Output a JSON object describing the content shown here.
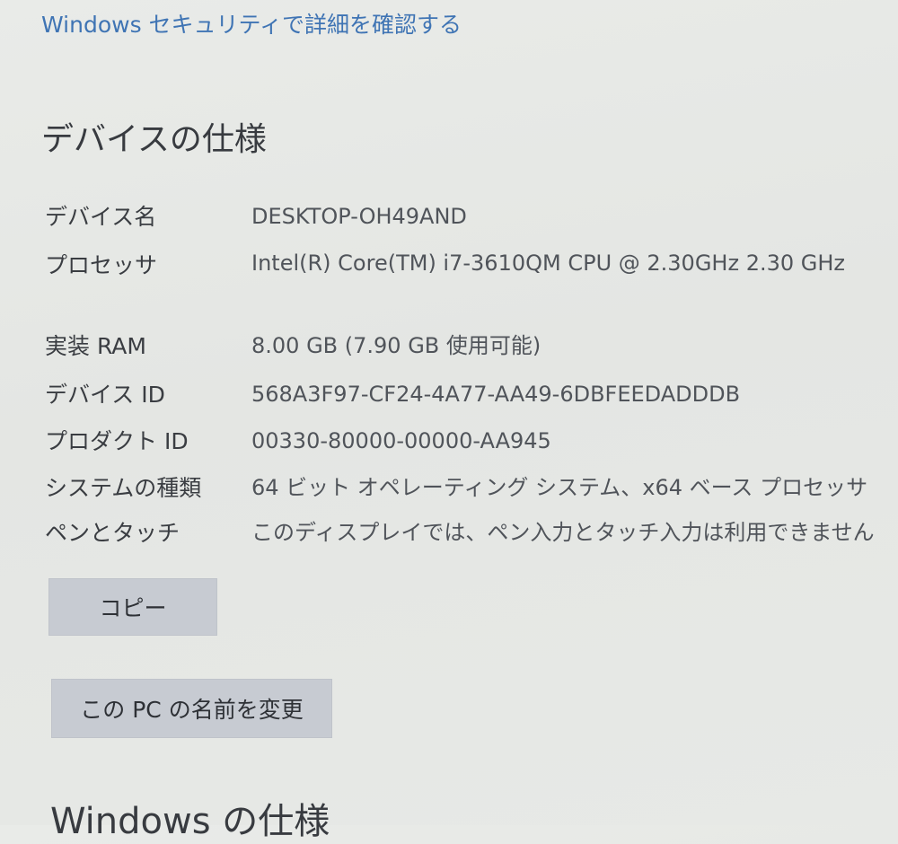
{
  "security_link": "Windows セキュリティで詳細を確認する",
  "device_specs": {
    "title": "デバイスの仕様",
    "rows": [
      {
        "label": "デバイス名",
        "value": "DESKTOP-OH49AND"
      },
      {
        "label": "プロセッサ",
        "value": "Intel(R) Core(TM) i7-3610QM CPU @ 2.30GHz   2.30 GHz"
      },
      {
        "label": "実装 RAM",
        "value": "8.00 GB (7.90 GB 使用可能)"
      },
      {
        "label": "デバイス ID",
        "value": "568A3F97-CF24-4A77-AA49-6DBFEEDADDDB"
      },
      {
        "label": "プロダクト ID",
        "value": "00330-80000-00000-AA945"
      },
      {
        "label": "システムの種類",
        "value": "64 ビット オペレーティング システム、x64 ベース プロセッサ"
      },
      {
        "label": "ペンとタッチ",
        "value": "このディスプレイでは、ペン入力とタッチ入力は利用できません"
      }
    ]
  },
  "buttons": {
    "copy": "コピー",
    "rename": "この PC の名前を変更"
  },
  "windows_specs": {
    "title": "Windows の仕様"
  }
}
